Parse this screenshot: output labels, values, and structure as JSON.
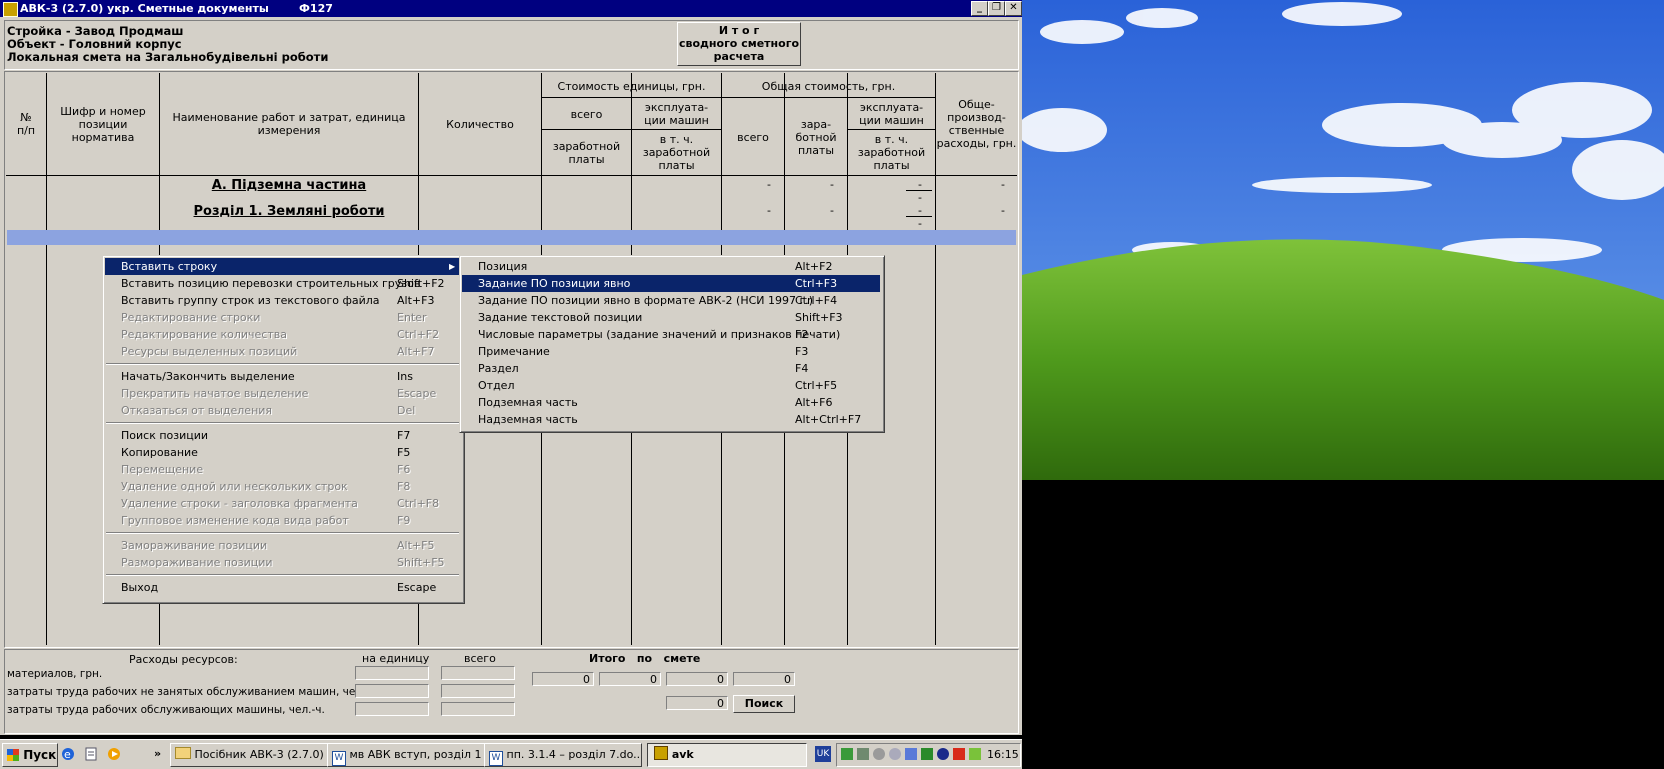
{
  "window": {
    "title": "АВК-3 (2.7.0)  укр.  Сметные документы",
    "code": "Ф127",
    "controls": {
      "minimize": "_",
      "restore": "❐",
      "close": "✕"
    }
  },
  "header": {
    "line1": "Стройка - Завод Продмаш",
    "line2": "Объект - Головний корпус",
    "line3": "Локальная смета на Загальнобудівельні роботи",
    "itog_button": [
      "И т о г",
      "сводного сметного",
      "расчета"
    ]
  },
  "table": {
    "columns": {
      "num": [
        "№",
        "п/п"
      ],
      "code": [
        "Шифр и номер",
        "позиции",
        "норматива"
      ],
      "name": [
        "Наименование работ и затрат, единица",
        "измерения"
      ],
      "qty": "Количество",
      "unit_cost": "Стоимость единицы, грн.",
      "unit_total": "всего",
      "unit_machines": [
        "эксплуата-",
        "ции машин"
      ],
      "unit_wages": [
        "заработной",
        "платы"
      ],
      "unit_incl_wages": [
        "в т. ч.",
        "заработной",
        "платы"
      ],
      "total_cost": "Общая стоимость, грн.",
      "total_all": "всего",
      "total_wages": [
        "зара-",
        "ботной",
        "платы"
      ],
      "total_machines": [
        "эксплуата-",
        "ции машин"
      ],
      "total_incl_wages": [
        "в т. ч.",
        "заработной",
        "платы"
      ],
      "overhead": [
        "Обще-",
        "производ-",
        "ственные",
        "расходы, грн."
      ]
    },
    "rows": [
      {
        "name": "А.   Підземна частина",
        "dash": "-"
      },
      {
        "name": "Розділ 1. Земляні роботи",
        "dash": "-"
      }
    ]
  },
  "context_menu": {
    "items": [
      {
        "label": "Вставить строку",
        "shortcut": "",
        "state": "highlighted",
        "submenu": true
      },
      {
        "label": "Вставить позицию перевозки строительных грузов",
        "shortcut": "Shift+F2",
        "state": "enabled"
      },
      {
        "label": "Вставить группу строк из текстового файла",
        "shortcut": "Alt+F3",
        "state": "enabled"
      },
      {
        "label": "Редактирование строки",
        "shortcut": "Enter",
        "state": "disabled"
      },
      {
        "label": "Редактирование количества",
        "shortcut": "Ctrl+F2",
        "state": "disabled"
      },
      {
        "label": "Ресурсы выделенных позиций",
        "shortcut": "Alt+F7",
        "state": "disabled"
      },
      {
        "label": "Начать/Закончить выделение",
        "shortcut": "Ins",
        "state": "enabled"
      },
      {
        "label": "Прекратить начатое выделение",
        "shortcut": "Escape",
        "state": "disabled"
      },
      {
        "label": "Отказаться от выделения",
        "shortcut": "Del",
        "state": "disabled"
      },
      {
        "label": "Поиск позиции",
        "shortcut": "F7",
        "state": "enabled"
      },
      {
        "label": "Копирование",
        "shortcut": "F5",
        "state": "enabled"
      },
      {
        "label": "Перемещение",
        "shortcut": "F6",
        "state": "disabled"
      },
      {
        "label": "Удаление одной или нескольких строк",
        "shortcut": "F8",
        "state": "disabled"
      },
      {
        "label": "Удаление строки - заголовка фрагмента",
        "shortcut": "Ctrl+F8",
        "state": "disabled"
      },
      {
        "label": "Групповое изменение кода вида работ",
        "shortcut": "F9",
        "state": "disabled"
      },
      {
        "label": "Замораживание позиции",
        "shortcut": "Alt+F5",
        "state": "disabled"
      },
      {
        "label": "Размораживание позиции",
        "shortcut": "Shift+F5",
        "state": "disabled"
      },
      {
        "label": "Выход",
        "shortcut": "Escape",
        "state": "enabled"
      }
    ]
  },
  "submenu": {
    "items": [
      {
        "label": "Позиция",
        "shortcut": "Alt+F2",
        "state": "enabled"
      },
      {
        "label": "Задание ПО позиции явно",
        "shortcut": "Ctrl+F3",
        "state": "highlighted"
      },
      {
        "label": "Задание ПО позиции явно в формате АВК-2 (НСИ 1997 г.)",
        "shortcut": "Ctrl+F4",
        "state": "enabled"
      },
      {
        "label": "Задание текстовой позиции",
        "shortcut": "Shift+F3",
        "state": "enabled"
      },
      {
        "label": "Числовые параметры (задание значений и признаков печати)",
        "shortcut": "F2",
        "state": "enabled"
      },
      {
        "label": "Примечание",
        "shortcut": "F3",
        "state": "enabled"
      },
      {
        "label": "Раздел",
        "shortcut": "F4",
        "state": "enabled"
      },
      {
        "label": "Отдел",
        "shortcut": "Ctrl+F5",
        "state": "enabled"
      },
      {
        "label": "Подземная часть",
        "shortcut": "Alt+F6",
        "state": "enabled"
      },
      {
        "label": "Надземная часть",
        "shortcut": "Alt+Ctrl+F7",
        "state": "enabled"
      }
    ]
  },
  "resources": {
    "title": "Расходы ресурсов:",
    "col_unit": "на единицу",
    "col_total": "всего",
    "row1": "материалов, грн.",
    "row2": "затраты труда рабочих не занятых обслуживанием машин, чел.-ч.",
    "row3": "затраты труда рабочих обслуживающих машины, чел.-ч.",
    "itogo": "Итого   по   смете",
    "totals": [
      "0",
      "0",
      "0",
      "0"
    ],
    "total_extra": "0",
    "search_button": "Поиск"
  },
  "taskbar": {
    "start": "Пуск",
    "arrows": "»",
    "tasks": [
      {
        "label": "Посібник АВК-3 (2.7.0)",
        "active": false
      },
      {
        "label": "мв АВК вступ, розділ 1 ...",
        "active": false
      },
      {
        "label": "пп. 3.1.4 – розділ 7.do...",
        "active": false
      },
      {
        "label": "avk",
        "active": true
      }
    ],
    "lang": "UK",
    "clock": "16:15"
  },
  "colors": {
    "window_face": "#d4d0c8",
    "titlebar": "#000080",
    "menu_highlight": "#0a246a",
    "selected_row": "#8ca3e0"
  }
}
